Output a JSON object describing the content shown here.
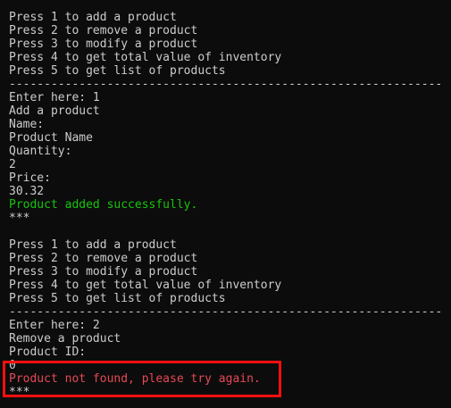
{
  "terminal": {
    "block1": {
      "menu": [
        "Press 1 to add a product",
        "Press 2 to remove a product",
        "Press 3 to modify a product",
        "Press 4 to get total value of inventory",
        "Press 5 to get list of products"
      ],
      "divider": "--------------------------------------------------------------",
      "prompt": "Enter here: 1",
      "action_title": "Add a product",
      "name_label": "Name:",
      "name_value": "Product Name",
      "quantity_label": "Quantity:",
      "quantity_value": "2",
      "price_label": "Price:",
      "price_value": "30.32",
      "result": "Product added successfully.",
      "separator": "***"
    },
    "block2": {
      "menu": [
        "Press 1 to add a product",
        "Press 2 to remove a product",
        "Press 3 to modify a product",
        "Press 4 to get total value of inventory",
        "Press 5 to get list of products"
      ],
      "divider": "--------------------------------------------------------------",
      "prompt": "Enter here: 2",
      "action_title": "Remove a product",
      "id_label": "Product ID:",
      "id_value": "0",
      "result": "Product not found, please try again.",
      "separator": "***"
    },
    "colors": {
      "background": "#0c0c0c",
      "text": "#cccccc",
      "success": "#16c60c",
      "error": "#e74856",
      "highlight_border": "#ff1010"
    }
  }
}
